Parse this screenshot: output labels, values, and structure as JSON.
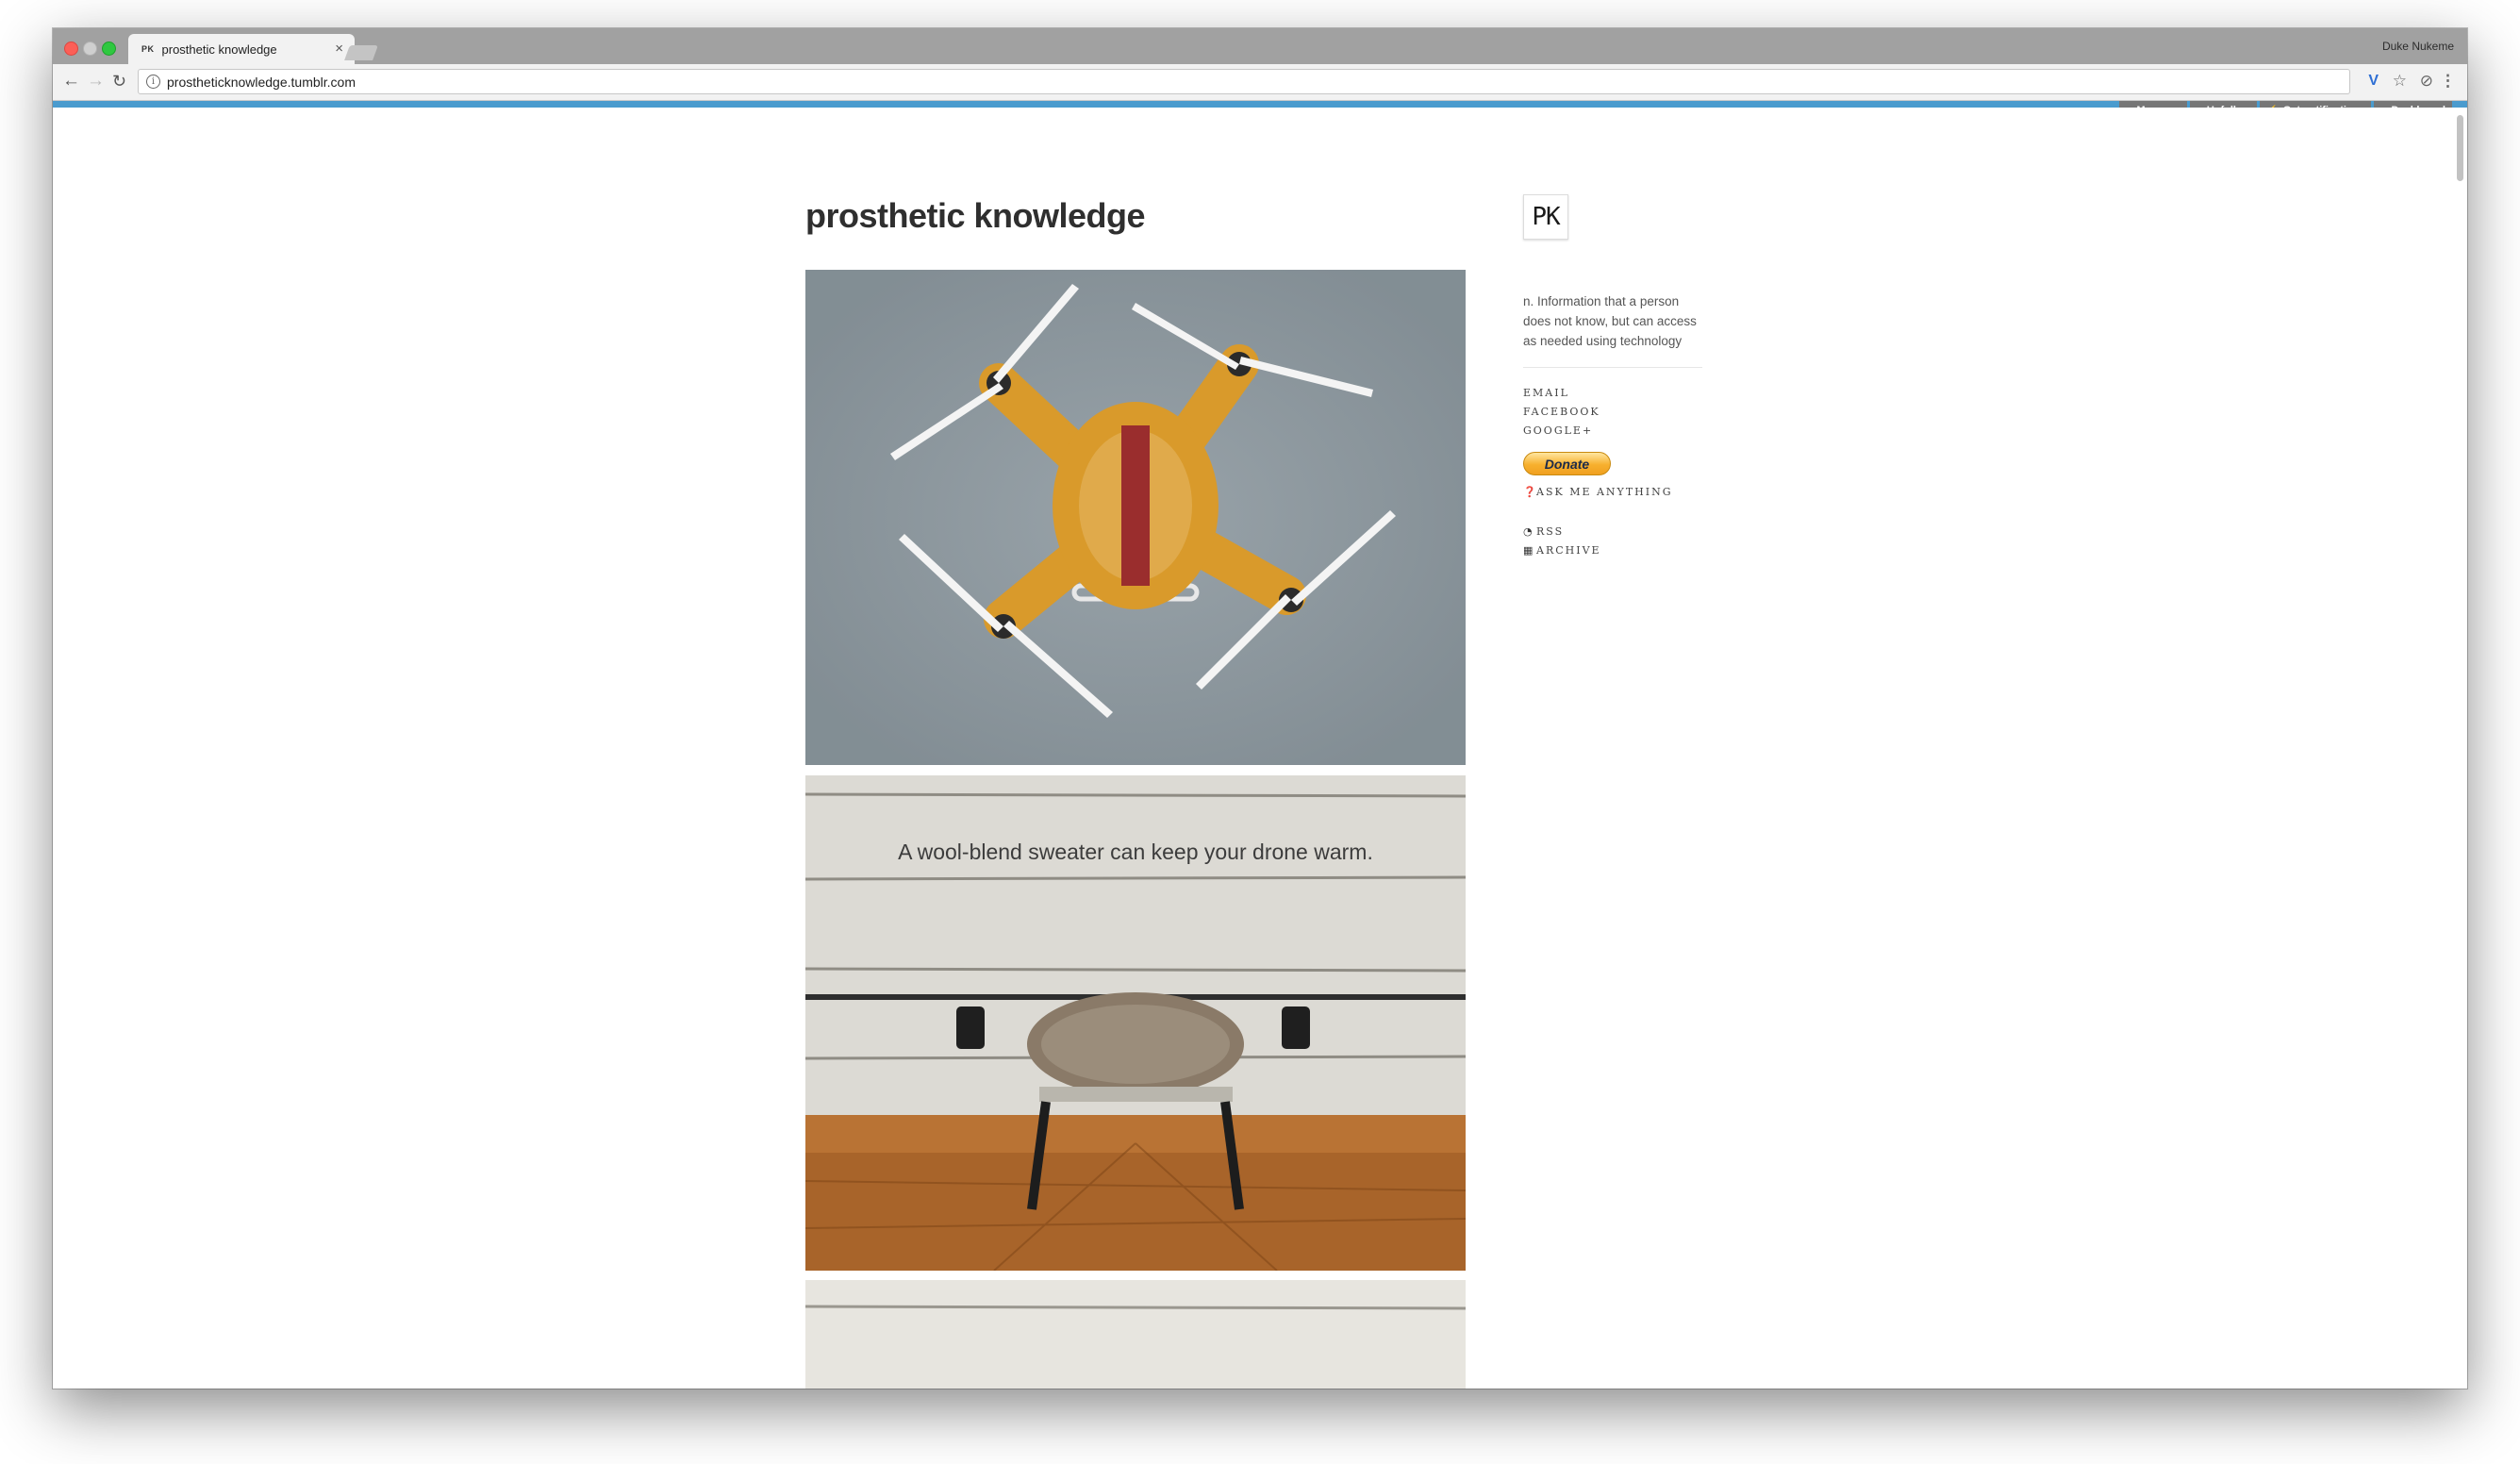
{
  "browser": {
    "tab_title": "prosthetic knowledge",
    "tab_favicon": "PK",
    "profile_name": "Duke Nukeme",
    "url": "prostheticknowledge.tumblr.com"
  },
  "tumblr_controls": {
    "message": "Message",
    "unfollow": "Unfollow",
    "notifications": "Get notifications",
    "dashboard": "Dashboard"
  },
  "blog": {
    "title": "prosthetic knowledge",
    "avatar_text": "PK",
    "description": "n. Information that a person does not know, but can access as needed using technology"
  },
  "posts": [
    {
      "caption": ""
    },
    {
      "caption": "A wool-blend sweater can keep your drone warm."
    },
    {
      "caption": ""
    }
  ],
  "sidebar": {
    "links": [
      "EMAIL",
      "FACEBOOK",
      "GOOGLE+"
    ],
    "donate_label": "Donate",
    "ask_label": "ASK ME ANYTHING",
    "rss_label": "RSS",
    "archive_label": "ARCHIVE"
  },
  "icons": {
    "back": "arrow-left-icon",
    "forward": "arrow-right-icon",
    "reload": "reload-icon",
    "info": "info-icon",
    "bookmark": "star-icon",
    "menu": "kebab-menu-icon",
    "ask": "question-circle-icon",
    "rss": "rss-icon",
    "archive": "grid-icon"
  },
  "colors": {
    "tumblr_bar": "#4a9bce",
    "tumblr_control_bg": "#767676",
    "title_text": "#2f2f2f",
    "donate_gold": "#f7b02e"
  }
}
